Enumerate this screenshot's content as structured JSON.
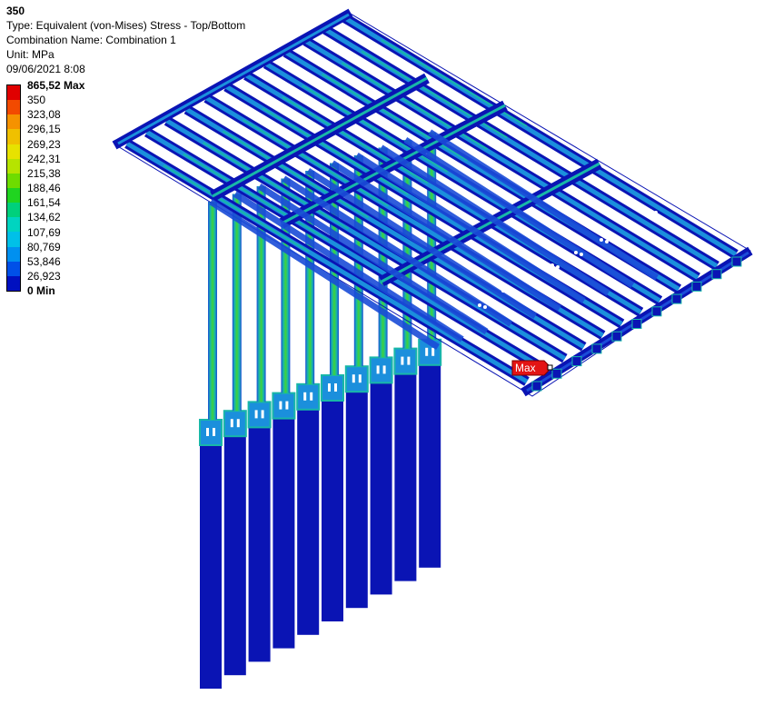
{
  "header": {
    "title": "350",
    "type_line": "Type: Equivalent (von-Mises) Stress - Top/Bottom",
    "combination_line": "Combination Name: Combination 1",
    "unit_line": "Unit: MPa",
    "date_line": "09/06/2021 8:08"
  },
  "legend": {
    "labels": [
      "865,52 Max",
      "350",
      "323,08",
      "296,15",
      "269,23",
      "242,31",
      "215,38",
      "188,46",
      "161,54",
      "134,62",
      "107,69",
      "80,769",
      "53,846",
      "26,923",
      "0 Min"
    ],
    "colors": [
      "#e00000",
      "#f24a00",
      "#f59200",
      "#f0c000",
      "#e7e200",
      "#b6e400",
      "#6edc00",
      "#20d420",
      "#00d07c",
      "#00d4c0",
      "#00c0e8",
      "#0090f0",
      "#0050e8",
      "#0010c0"
    ]
  },
  "model": {
    "colors": {
      "dark_blue": "#0a14b4",
      "mid_blue": "#1a4cd8",
      "cyan_blue": "#1b8fdc",
      "teal": "#18b7a8",
      "green": "#3fd23a",
      "max_red": "#e31414"
    }
  },
  "max_probe": {
    "label": "Max"
  }
}
